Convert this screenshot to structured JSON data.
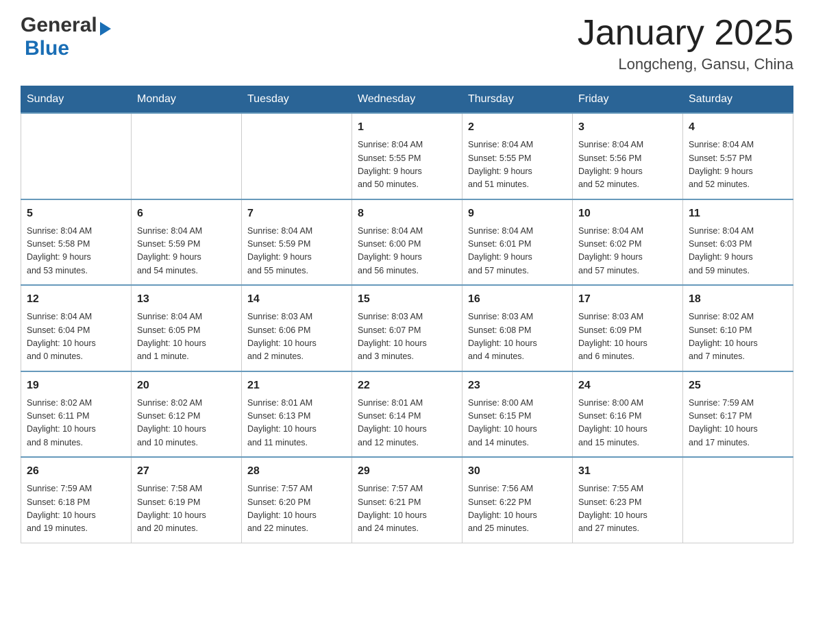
{
  "header": {
    "logo_general": "General",
    "logo_blue": "Blue",
    "month": "January 2025",
    "location": "Longcheng, Gansu, China"
  },
  "days_of_week": [
    "Sunday",
    "Monday",
    "Tuesday",
    "Wednesday",
    "Thursday",
    "Friday",
    "Saturday"
  ],
  "weeks": [
    [
      {
        "day": "",
        "info": ""
      },
      {
        "day": "",
        "info": ""
      },
      {
        "day": "",
        "info": ""
      },
      {
        "day": "1",
        "info": "Sunrise: 8:04 AM\nSunset: 5:55 PM\nDaylight: 9 hours\nand 50 minutes."
      },
      {
        "day": "2",
        "info": "Sunrise: 8:04 AM\nSunset: 5:55 PM\nDaylight: 9 hours\nand 51 minutes."
      },
      {
        "day": "3",
        "info": "Sunrise: 8:04 AM\nSunset: 5:56 PM\nDaylight: 9 hours\nand 52 minutes."
      },
      {
        "day": "4",
        "info": "Sunrise: 8:04 AM\nSunset: 5:57 PM\nDaylight: 9 hours\nand 52 minutes."
      }
    ],
    [
      {
        "day": "5",
        "info": "Sunrise: 8:04 AM\nSunset: 5:58 PM\nDaylight: 9 hours\nand 53 minutes."
      },
      {
        "day": "6",
        "info": "Sunrise: 8:04 AM\nSunset: 5:59 PM\nDaylight: 9 hours\nand 54 minutes."
      },
      {
        "day": "7",
        "info": "Sunrise: 8:04 AM\nSunset: 5:59 PM\nDaylight: 9 hours\nand 55 minutes."
      },
      {
        "day": "8",
        "info": "Sunrise: 8:04 AM\nSunset: 6:00 PM\nDaylight: 9 hours\nand 56 minutes."
      },
      {
        "day": "9",
        "info": "Sunrise: 8:04 AM\nSunset: 6:01 PM\nDaylight: 9 hours\nand 57 minutes."
      },
      {
        "day": "10",
        "info": "Sunrise: 8:04 AM\nSunset: 6:02 PM\nDaylight: 9 hours\nand 57 minutes."
      },
      {
        "day": "11",
        "info": "Sunrise: 8:04 AM\nSunset: 6:03 PM\nDaylight: 9 hours\nand 59 minutes."
      }
    ],
    [
      {
        "day": "12",
        "info": "Sunrise: 8:04 AM\nSunset: 6:04 PM\nDaylight: 10 hours\nand 0 minutes."
      },
      {
        "day": "13",
        "info": "Sunrise: 8:04 AM\nSunset: 6:05 PM\nDaylight: 10 hours\nand 1 minute."
      },
      {
        "day": "14",
        "info": "Sunrise: 8:03 AM\nSunset: 6:06 PM\nDaylight: 10 hours\nand 2 minutes."
      },
      {
        "day": "15",
        "info": "Sunrise: 8:03 AM\nSunset: 6:07 PM\nDaylight: 10 hours\nand 3 minutes."
      },
      {
        "day": "16",
        "info": "Sunrise: 8:03 AM\nSunset: 6:08 PM\nDaylight: 10 hours\nand 4 minutes."
      },
      {
        "day": "17",
        "info": "Sunrise: 8:03 AM\nSunset: 6:09 PM\nDaylight: 10 hours\nand 6 minutes."
      },
      {
        "day": "18",
        "info": "Sunrise: 8:02 AM\nSunset: 6:10 PM\nDaylight: 10 hours\nand 7 minutes."
      }
    ],
    [
      {
        "day": "19",
        "info": "Sunrise: 8:02 AM\nSunset: 6:11 PM\nDaylight: 10 hours\nand 8 minutes."
      },
      {
        "day": "20",
        "info": "Sunrise: 8:02 AM\nSunset: 6:12 PM\nDaylight: 10 hours\nand 10 minutes."
      },
      {
        "day": "21",
        "info": "Sunrise: 8:01 AM\nSunset: 6:13 PM\nDaylight: 10 hours\nand 11 minutes."
      },
      {
        "day": "22",
        "info": "Sunrise: 8:01 AM\nSunset: 6:14 PM\nDaylight: 10 hours\nand 12 minutes."
      },
      {
        "day": "23",
        "info": "Sunrise: 8:00 AM\nSunset: 6:15 PM\nDaylight: 10 hours\nand 14 minutes."
      },
      {
        "day": "24",
        "info": "Sunrise: 8:00 AM\nSunset: 6:16 PM\nDaylight: 10 hours\nand 15 minutes."
      },
      {
        "day": "25",
        "info": "Sunrise: 7:59 AM\nSunset: 6:17 PM\nDaylight: 10 hours\nand 17 minutes."
      }
    ],
    [
      {
        "day": "26",
        "info": "Sunrise: 7:59 AM\nSunset: 6:18 PM\nDaylight: 10 hours\nand 19 minutes."
      },
      {
        "day": "27",
        "info": "Sunrise: 7:58 AM\nSunset: 6:19 PM\nDaylight: 10 hours\nand 20 minutes."
      },
      {
        "day": "28",
        "info": "Sunrise: 7:57 AM\nSunset: 6:20 PM\nDaylight: 10 hours\nand 22 minutes."
      },
      {
        "day": "29",
        "info": "Sunrise: 7:57 AM\nSunset: 6:21 PM\nDaylight: 10 hours\nand 24 minutes."
      },
      {
        "day": "30",
        "info": "Sunrise: 7:56 AM\nSunset: 6:22 PM\nDaylight: 10 hours\nand 25 minutes."
      },
      {
        "day": "31",
        "info": "Sunrise: 7:55 AM\nSunset: 6:23 PM\nDaylight: 10 hours\nand 27 minutes."
      },
      {
        "day": "",
        "info": ""
      }
    ]
  ]
}
